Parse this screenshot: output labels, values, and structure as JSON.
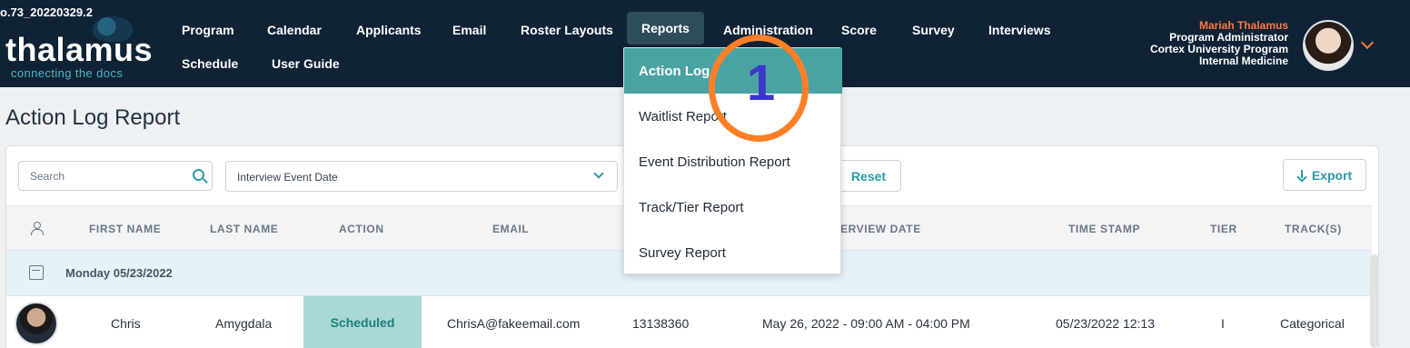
{
  "version": "o.73_20220329.2",
  "brand": {
    "name": "thalamus",
    "tagline": "connecting the docs"
  },
  "nav": {
    "row1": [
      "Program",
      "Calendar",
      "Applicants",
      "Email",
      "Roster Layouts",
      "Reports",
      "Administration",
      "Score",
      "Survey",
      "Interviews"
    ],
    "row2": [
      "Schedule",
      "User Guide"
    ]
  },
  "user": {
    "name": "Mariah Thalamus",
    "role": "Program Administrator",
    "program": "Cortex University Program",
    "department": "Internal Medicine"
  },
  "page": {
    "title": "Action Log Report"
  },
  "filters": {
    "search_placeholder": "Search",
    "date_select_label": "Interview Event Date",
    "reset_label": "Reset",
    "export_label": "Export"
  },
  "table": {
    "headers": [
      "FIRST NAME",
      "LAST NAME",
      "ACTION",
      "EMAIL",
      "ERVIEW DATE",
      "TIME STAMP",
      "TIER",
      "TRACK(S)"
    ],
    "group_label": "Monday 05/23/2022",
    "rows": [
      {
        "first_name": "Chris",
        "last_name": "Amygdala",
        "action": "Scheduled",
        "email": "ChrisA@fakeemail.com",
        "id": "13138360",
        "interview_date": "May 26, 2022 - 09:00 AM - 04:00 PM",
        "time_stamp": "05/23/2022 12:13",
        "tier": "I",
        "tracks": "Categorical"
      }
    ]
  },
  "reports_menu": [
    "Action Log",
    "Waitlist Report",
    "Event Distribution Report",
    "Track/Tier Report",
    "Survey Report"
  ],
  "annotation": {
    "number": "1"
  },
  "colors": {
    "navy": "#0f2236",
    "teal": "#2b9aa7",
    "orange": "#ff7f27"
  }
}
